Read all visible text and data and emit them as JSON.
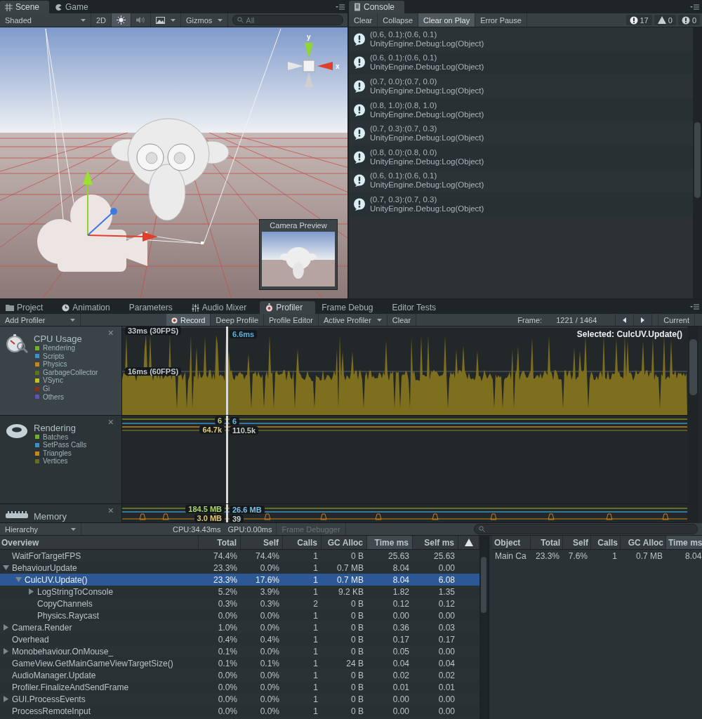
{
  "scene_panel": {
    "tabs": [
      {
        "label": "Scene",
        "kind": "scene",
        "selected": true
      },
      {
        "label": "Game",
        "kind": "game",
        "selected": false
      }
    ],
    "toolbar": {
      "shading": "Shaded",
      "mode_2d": {
        "label": "2D",
        "on": false
      },
      "lighting_on": true,
      "audio_on": false,
      "gizmos": "Gizmos",
      "search_placeholder": "All"
    },
    "gizmo": {
      "y_label": "y",
      "x_label": "x"
    },
    "camera_preview": {
      "title": "Camera Preview"
    }
  },
  "console": {
    "tab": "Console",
    "buttons": [
      {
        "label": "Clear",
        "on": false
      },
      {
        "label": "Collapse",
        "on": false
      },
      {
        "label": "Clear on Play",
        "on": true
      },
      {
        "label": "Error Pause",
        "on": false
      }
    ],
    "counts": [
      {
        "kind": "info",
        "count": "17"
      },
      {
        "kind": "warning",
        "count": "0"
      },
      {
        "kind": "error",
        "count": "0"
      }
    ],
    "entries": [
      {
        "message": "(0.6, 0.1):(0.6, 0.1)",
        "trace": "UnityEngine.Debug:Log(Object)"
      },
      {
        "message": "(0.6, 0.1):(0.6, 0.1)",
        "trace": "UnityEngine.Debug:Log(Object)"
      },
      {
        "message": "(0.7, 0.0):(0.7, 0.0)",
        "trace": "UnityEngine.Debug:Log(Object)"
      },
      {
        "message": "(0.8, 1.0):(0.8, 1.0)",
        "trace": "UnityEngine.Debug:Log(Object)"
      },
      {
        "message": "(0.7, 0.3):(0.7, 0.3)",
        "trace": "UnityEngine.Debug:Log(Object)"
      },
      {
        "message": "(0.8, 0.0):(0.8, 0.0)",
        "trace": "UnityEngine.Debug:Log(Object)"
      },
      {
        "message": "(0.6, 0.1):(0.6, 0.1)",
        "trace": "UnityEngine.Debug:Log(Object)"
      },
      {
        "message": "(0.7, 0.3):(0.7, 0.3)",
        "trace": "UnityEngine.Debug:Log(Object)"
      }
    ]
  },
  "profiler": {
    "tabs": [
      {
        "label": "Project",
        "kind": "folder",
        "selected": false
      },
      {
        "label": "Animation",
        "kind": "clock",
        "selected": false
      },
      {
        "label": "Parameters",
        "kind": "plain",
        "selected": false
      },
      {
        "label": "Audio Mixer",
        "kind": "mixer",
        "selected": false
      },
      {
        "label": "Profiler",
        "kind": "profiler",
        "selected": true
      },
      {
        "label": "Frame Debug",
        "kind": "plain",
        "selected": false
      },
      {
        "label": "Editor Tests",
        "kind": "plain",
        "selected": false
      }
    ],
    "toolbar": {
      "add_profiler": "Add Profiler",
      "buttons": [
        {
          "label": "Record",
          "kind": "record",
          "on": true
        },
        {
          "label": "Deep Profile",
          "kind": "plain",
          "on": false
        },
        {
          "label": "Profile Editor",
          "kind": "plain",
          "on": false
        },
        {
          "label": "Active Profiler",
          "kind": "dropdown",
          "on": false
        },
        {
          "label": "Clear",
          "kind": "plain",
          "on": false
        }
      ],
      "frame_label": "Frame:",
      "frame_value": "1221 / 1464",
      "current": "Current"
    },
    "modules": [
      {
        "kind": "cpu",
        "title": "CPU Usage",
        "close": "×",
        "selected": true,
        "legend": [
          {
            "label": "Rendering",
            "color": "#6fb326"
          },
          {
            "label": "Scripts",
            "color": "#3a92c8"
          },
          {
            "label": "Physics",
            "color": "#c8851a"
          },
          {
            "label": "GarbageCollector",
            "color": "#63701c"
          },
          {
            "label": "VSync",
            "color": "#c6bf1c"
          },
          {
            "label": "Gi",
            "color": "#8a3212"
          },
          {
            "label": "Others",
            "color": "#6650b4"
          }
        ],
        "grid_labels": [
          "33ms (30FPS)",
          "16ms (60FPS)"
        ],
        "selected_label": "Selected: CulcUV.Update()",
        "readouts": [
          {
            "text": "6.6ms",
            "color": "#5cb0e0"
          }
        ]
      },
      {
        "kind": "rendering",
        "title": "Rendering",
        "close": "×",
        "selected": false,
        "legend": [
          {
            "label": "Batches",
            "color": "#6fb326"
          },
          {
            "label": "SetPass Calls",
            "color": "#3a92c8"
          },
          {
            "label": "Triangles",
            "color": "#c8851a"
          },
          {
            "label": "Vertices",
            "color": "#63701c"
          }
        ],
        "readouts": [
          {
            "text": "6",
            "color": "#b9c56c"
          },
          {
            "text": "6",
            "color": "#6cb6e0"
          },
          {
            "text": "64.7k",
            "color": "#e2c773"
          },
          {
            "text": "110.5k",
            "color": "#c8cfc2"
          }
        ]
      },
      {
        "kind": "memory",
        "title": "Memory",
        "close": "×",
        "selected": false,
        "readouts": [
          {
            "text": "184.5 MB",
            "color": "#a9d36c"
          },
          {
            "text": "26.6 MB",
            "color": "#7cc0e6"
          },
          {
            "text": "3.0 MB",
            "color": "#e2c773"
          },
          {
            "text": "39",
            "color": "#c8cfc2"
          }
        ]
      }
    ]
  },
  "details": {
    "view_mode": "Hierarchy",
    "cpu": "CPU:34.43ms",
    "gpu": "GPU:0.00ms",
    "frame_debugger": {
      "label": "Frame Debugger",
      "disabled": true
    },
    "columns": [
      {
        "label": "Overview",
        "sorted": false
      },
      {
        "label": "Total",
        "sorted": false
      },
      {
        "label": "Self",
        "sorted": false
      },
      {
        "label": "Calls",
        "sorted": false
      },
      {
        "label": "GC Alloc",
        "sorted": false
      },
      {
        "label": "Time ms",
        "sorted": true
      },
      {
        "label": "Self ms",
        "sorted": false
      }
    ],
    "rows": [
      {
        "name": "WaitForTargetFPS",
        "values": [
          "74.4%",
          "74.4%",
          "1",
          "0 B",
          "25.63",
          "25.63"
        ],
        "selected": false
      },
      {
        "name": "BehaviourUpdate",
        "values": [
          "23.3%",
          "0.0%",
          "1",
          "0.7 MB",
          "8.04",
          "0.00"
        ],
        "selected": false,
        "expanded": true,
        "children": [
          {
            "name": "CulcUV.Update()",
            "values": [
              "23.3%",
              "17.6%",
              "1",
              "0.7 MB",
              "8.04",
              "6.08"
            ],
            "selected": true,
            "expanded": true,
            "children": [
              {
                "name": "LogStringToConsole",
                "values": [
                  "5.2%",
                  "3.9%",
                  "1",
                  "9.2 KB",
                  "1.82",
                  "1.35"
                ],
                "selected": false,
                "expanded": false
              },
              {
                "name": "CopyChannels",
                "values": [
                  "0.3%",
                  "0.3%",
                  "2",
                  "0 B",
                  "0.12",
                  "0.12"
                ],
                "selected": false
              },
              {
                "name": "Physics.Raycast",
                "values": [
                  "0.0%",
                  "0.0%",
                  "1",
                  "0 B",
                  "0.00",
                  "0.00"
                ],
                "selected": false
              }
            ]
          }
        ]
      },
      {
        "name": "Camera.Render",
        "values": [
          "1.0%",
          "0.0%",
          "1",
          "0 B",
          "0.36",
          "0.03"
        ],
        "selected": false,
        "expanded": false
      },
      {
        "name": "Overhead",
        "values": [
          "0.4%",
          "0.4%",
          "1",
          "0 B",
          "0.17",
          "0.17"
        ],
        "selected": false
      },
      {
        "name": "Monobehaviour.OnMouse_",
        "values": [
          "0.1%",
          "0.0%",
          "1",
          "0 B",
          "0.05",
          "0.00"
        ],
        "selected": false,
        "expanded": false
      },
      {
        "name": "GameView.GetMainGameViewTargetSize()",
        "values": [
          "0.1%",
          "0.1%",
          "1",
          "24 B",
          "0.04",
          "0.04"
        ],
        "selected": false
      },
      {
        "name": "AudioManager.Update",
        "values": [
          "0.0%",
          "0.0%",
          "1",
          "0 B",
          "0.02",
          "0.02"
        ],
        "selected": false
      },
      {
        "name": "Profiler.FinalizeAndSendFrame",
        "values": [
          "0.0%",
          "0.0%",
          "1",
          "0 B",
          "0.01",
          "0.01"
        ],
        "selected": false
      },
      {
        "name": "GUI.ProcessEvents",
        "values": [
          "0.0%",
          "0.0%",
          "1",
          "0 B",
          "0.00",
          "0.00"
        ],
        "selected": false,
        "expanded": false
      },
      {
        "name": "ProcessRemoteInput",
        "values": [
          "0.0%",
          "0.0%",
          "1",
          "0 B",
          "0.00",
          "0.00"
        ],
        "selected": false
      }
    ],
    "object_table": {
      "columns": [
        {
          "label": "Object",
          "sorted": false
        },
        {
          "label": "Total",
          "sorted": false
        },
        {
          "label": "Self",
          "sorted": false
        },
        {
          "label": "Calls",
          "sorted": false
        },
        {
          "label": "GC Alloc",
          "sorted": false
        },
        {
          "label": "Time ms",
          "sorted": true
        }
      ],
      "rows": [
        {
          "values": [
            "Main Ca",
            "23.3%",
            "7.6%",
            "1",
            "0.7 MB",
            "8.04"
          ]
        }
      ]
    }
  }
}
